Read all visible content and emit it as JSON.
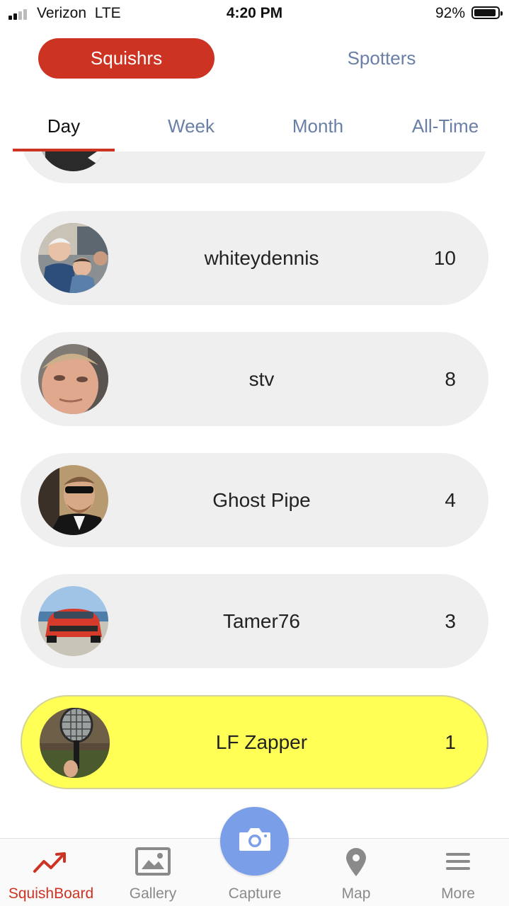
{
  "status_bar": {
    "carrier": "Verizon",
    "network": "LTE",
    "time": "4:20 PM",
    "battery": "92%"
  },
  "segments": {
    "active": "Squishrs",
    "inactive": "Spotters"
  },
  "tabs": [
    {
      "label": "Day",
      "active": true
    },
    {
      "label": "Week",
      "active": false
    },
    {
      "label": "Month",
      "active": false
    },
    {
      "label": "All-Time",
      "active": false
    }
  ],
  "leaderboard": [
    {
      "name": "whiteydennis",
      "score": "10"
    },
    {
      "name": "stv",
      "score": "8"
    },
    {
      "name": "Ghost Pipe",
      "score": "4"
    },
    {
      "name": "Tamer76",
      "score": "3"
    },
    {
      "name": "LF Zapper",
      "score": "1",
      "highlight": true
    }
  ],
  "bottom_nav": [
    {
      "label": "SquishBoard",
      "icon": "trending-up-icon",
      "active": true
    },
    {
      "label": "Gallery",
      "icon": "image-icon",
      "active": false
    },
    {
      "label": "Capture",
      "icon": "camera-icon",
      "active": false
    },
    {
      "label": "Map",
      "icon": "map-pin-icon",
      "active": false
    },
    {
      "label": "More",
      "icon": "menu-icon",
      "active": false
    }
  ],
  "colors": {
    "accent": "#cc3322",
    "inactive_text": "#6a7fa6",
    "row_bg": "#efefef",
    "highlight_bg": "#ffff55",
    "capture_bg": "#7b9ee8"
  }
}
